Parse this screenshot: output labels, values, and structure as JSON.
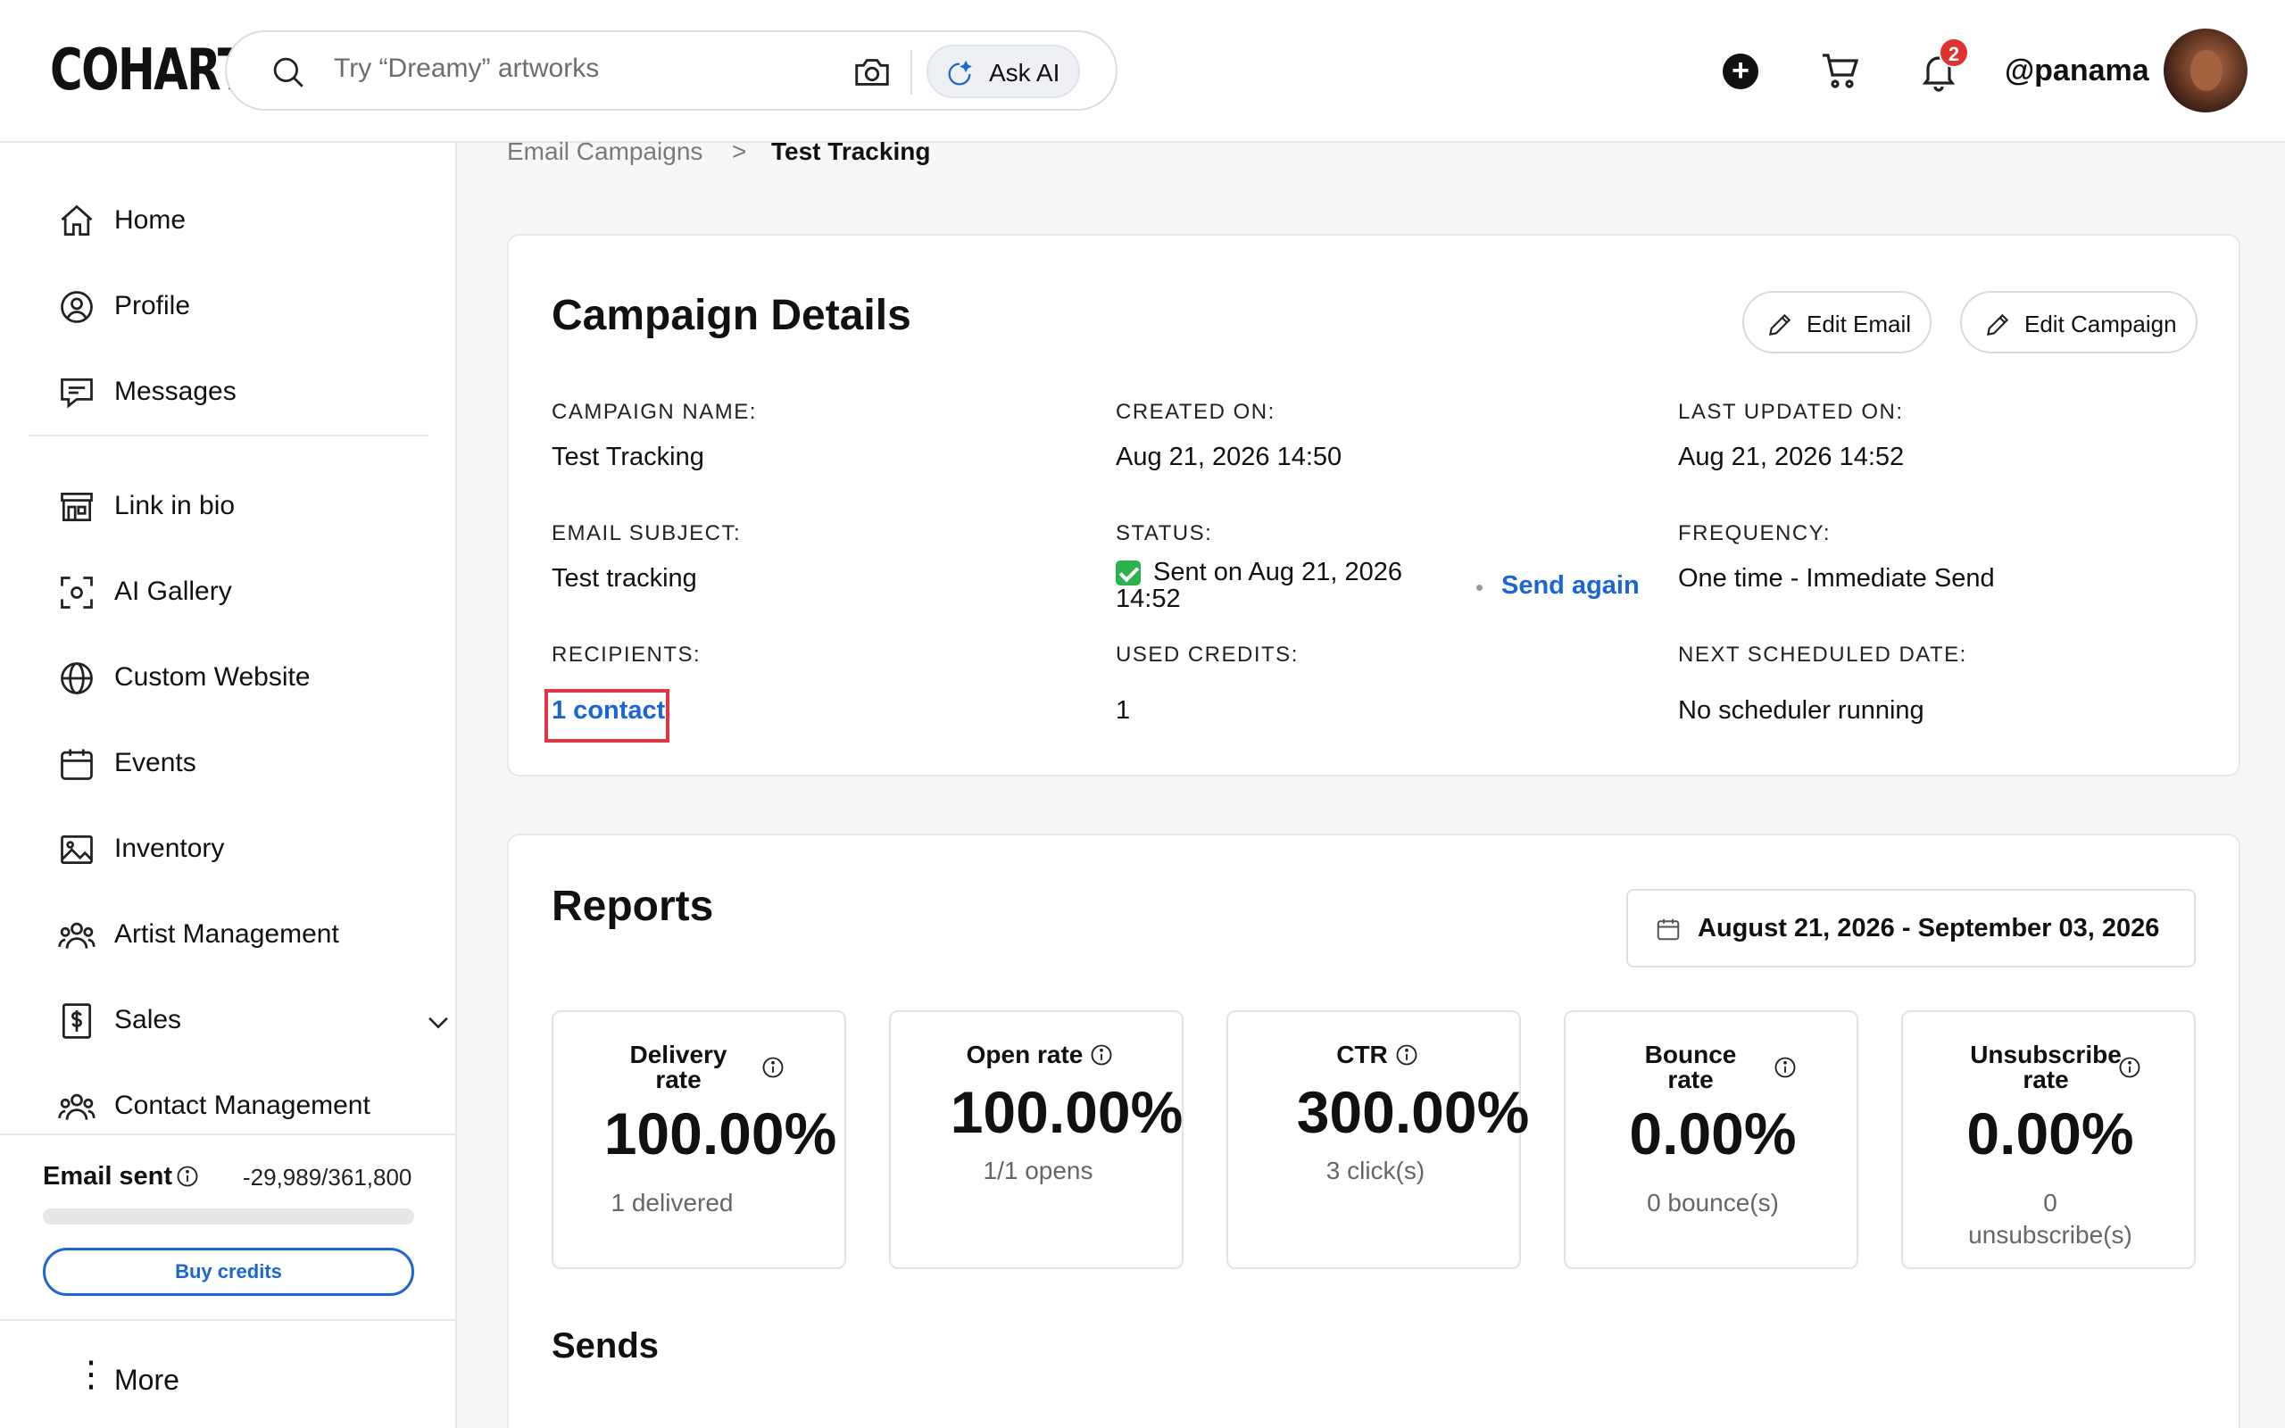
{
  "header": {
    "logo": "COHART",
    "search_placeholder": "Try “Dreamy” artworks",
    "ask_ai_label": "Ask AI",
    "notification_count": "2",
    "username": "@panama"
  },
  "sidebar": {
    "items": [
      {
        "label": "Home",
        "icon": "home-icon"
      },
      {
        "label": "Profile",
        "icon": "profile-icon"
      },
      {
        "label": "Messages",
        "icon": "messages-icon"
      },
      {
        "label": "Link in bio",
        "icon": "storefront-icon"
      },
      {
        "label": "AI Gallery",
        "icon": "ai-scan-icon"
      },
      {
        "label": "Custom Website",
        "icon": "globe-icon"
      },
      {
        "label": "Events",
        "icon": "calendar-icon"
      },
      {
        "label": "Inventory",
        "icon": "image-icon"
      },
      {
        "label": "Artist Management",
        "icon": "users-icon"
      },
      {
        "label": "Sales",
        "icon": "dollar-doc-icon"
      },
      {
        "label": "Contact Management",
        "icon": "contacts-icon"
      }
    ],
    "email_sent_label": "Email sent",
    "email_sent_count": "-29,989/361,800",
    "email_sent_fraction": 0,
    "buy_credits_label": "Buy credits",
    "more_label": "More"
  },
  "breadcrumb": {
    "parent": "Email Campaigns",
    "separator": ">",
    "current": "Test Tracking"
  },
  "campaign": {
    "title": "Campaign Details",
    "edit_email_label": "Edit Email",
    "edit_campaign_label": "Edit Campaign",
    "fields": {
      "name_label": "CAMPAIGN NAME:",
      "name_value": "Test Tracking",
      "created_label": "CREATED ON:",
      "created_value": "Aug 21, 2026 14:50",
      "updated_label": "LAST UPDATED ON:",
      "updated_value": "Aug 21, 2026 14:52",
      "subject_label": "EMAIL SUBJECT:",
      "subject_value": "Test tracking",
      "status_label": "STATUS:",
      "status_value_line1": "Sent on Aug 21, 2026",
      "status_value_line2": "14:52",
      "send_again_label": "Send again",
      "frequency_label": "FREQUENCY:",
      "frequency_value": "One time - Immediate Send",
      "recipients_label": "RECIPIENTS:",
      "recipients_value": "1 contact",
      "credits_label": "USED CREDITS:",
      "credits_value": "1",
      "next_label": "NEXT SCHEDULED DATE:",
      "next_value": "No scheduler running"
    }
  },
  "reports": {
    "title": "Reports",
    "date_range": "August 21, 2026 - September 03, 2026",
    "stats": [
      {
        "title_line1": "Delivery",
        "title_line2": "rate",
        "value": "100.00%",
        "sub_line1": "1 delivered",
        "sub_line2": ""
      },
      {
        "title_line1": "Open rate",
        "title_line2": "",
        "value": "100.00%",
        "sub_line1": "1/1 opens",
        "sub_line2": ""
      },
      {
        "title_line1": "CTR",
        "title_line2": "",
        "value": "300.00%",
        "sub_line1": "3 click(s)",
        "sub_line2": ""
      },
      {
        "title_line1": "Bounce",
        "title_line2": "rate",
        "value": "0.00%",
        "sub_line1": "0 bounce(s)",
        "sub_line2": ""
      },
      {
        "title_line1": "Unsubscribe",
        "title_line2": "rate",
        "value": "0.00%",
        "sub_line1": "0",
        "sub_line2": "unsubscribe(s)"
      }
    ],
    "sends_title": "Sends"
  },
  "colors": {
    "accent": "#1a66d9",
    "highlight": "#e03546",
    "badge": "#e03131",
    "status_ok": "#2bb24c"
  }
}
